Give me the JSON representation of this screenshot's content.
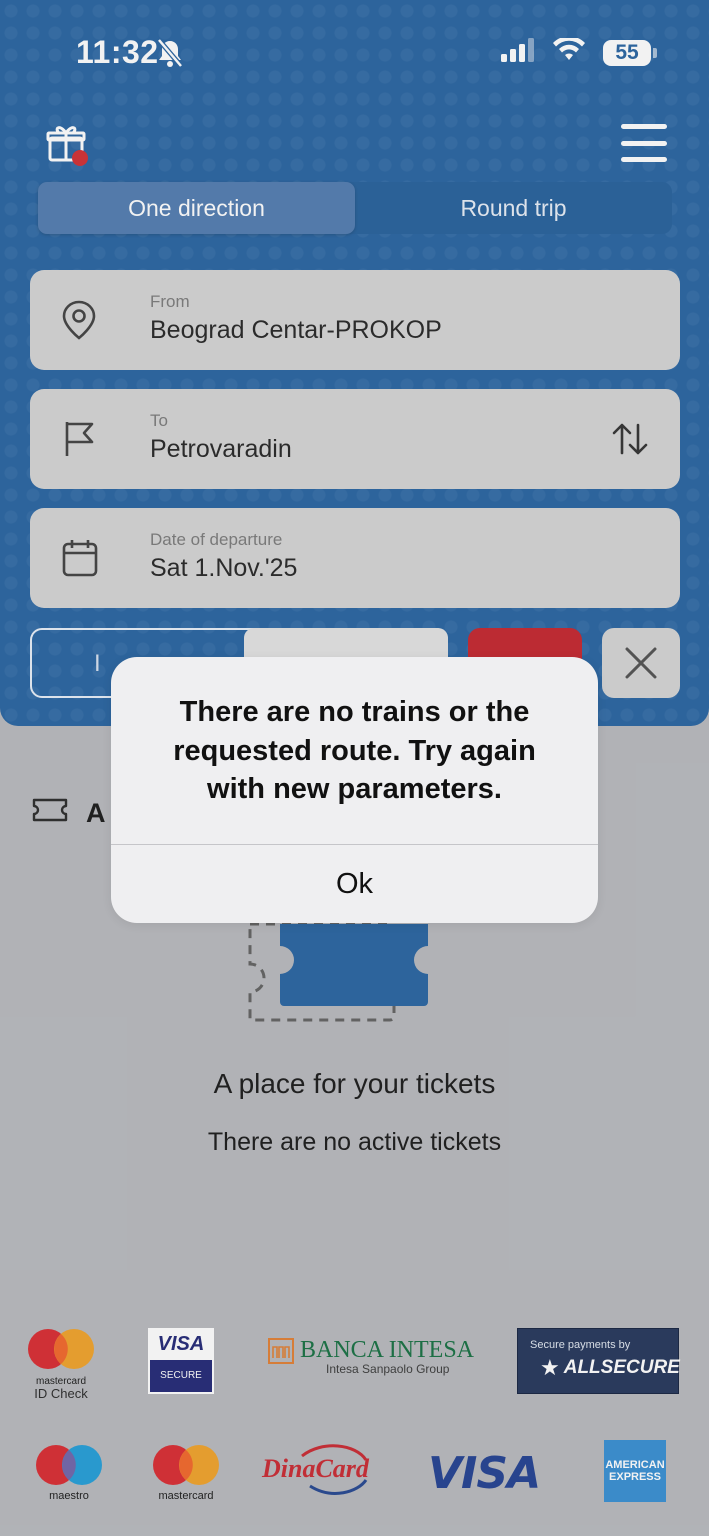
{
  "status_bar": {
    "time": "11:32",
    "battery": "55"
  },
  "trip_toggle": {
    "options": [
      "One direction",
      "Round trip"
    ],
    "selected": "One direction"
  },
  "form": {
    "from": {
      "label": "From",
      "value": "Beograd Centar-PROKOP"
    },
    "to": {
      "label": "To",
      "value": "Petrovaradin"
    },
    "date": {
      "label": "Date of departure",
      "value": "Sat 1.Nov.'25"
    },
    "passenger_hint": "I"
  },
  "tickets": {
    "section_title": "A",
    "empty_title": "A place for your tickets",
    "empty_subtitle": "There are no active tickets"
  },
  "alert": {
    "message": "There are no trains or the requested route. Try again with new parameters.",
    "button": "Ok"
  },
  "payments": {
    "mastercard_id": "mastercard",
    "mastercard_id_sub": "ID Check",
    "visa_secure_top": "VISA",
    "visa_secure_bottom": "SECURE",
    "banca_name": "BANCA INTESA",
    "banca_group": "Intesa Sanpaolo Group",
    "allsecure_top": "Secure payments by",
    "allsecure_name": "ALLSECURE",
    "maestro": "maestro",
    "mastercard": "mastercard",
    "dinacard": "DinaCard",
    "visa": "VISA",
    "amex_top": "AMERICAN",
    "amex_bottom": "EXPRESS"
  },
  "colors": {
    "brand_blue": "#1f5e9e",
    "accent_red": "#c21d26",
    "field_bg": "#d3d3d3"
  }
}
